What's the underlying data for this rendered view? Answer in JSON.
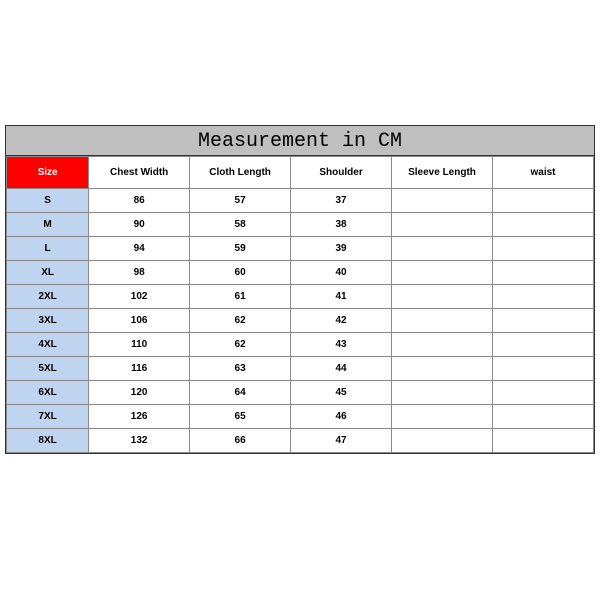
{
  "title": "Measurement in CM",
  "headers": {
    "size": "Size",
    "chest": "Chest Width",
    "length": "Cloth Length",
    "shoulder": "Shoulder",
    "sleeve": "Sleeve Length",
    "waist": "waist"
  },
  "rows": [
    {
      "size": "S",
      "chest": "86",
      "length": "57",
      "shoulder": "37",
      "sleeve": "",
      "waist": ""
    },
    {
      "size": "M",
      "chest": "90",
      "length": "58",
      "shoulder": "38",
      "sleeve": "",
      "waist": ""
    },
    {
      "size": "L",
      "chest": "94",
      "length": "59",
      "shoulder": "39",
      "sleeve": "",
      "waist": ""
    },
    {
      "size": "XL",
      "chest": "98",
      "length": "60",
      "shoulder": "40",
      "sleeve": "",
      "waist": ""
    },
    {
      "size": "2XL",
      "chest": "102",
      "length": "61",
      "shoulder": "41",
      "sleeve": "",
      "waist": ""
    },
    {
      "size": "3XL",
      "chest": "106",
      "length": "62",
      "shoulder": "42",
      "sleeve": "",
      "waist": ""
    },
    {
      "size": "4XL",
      "chest": "110",
      "length": "62",
      "shoulder": "43",
      "sleeve": "",
      "waist": ""
    },
    {
      "size": "5XL",
      "chest": "116",
      "length": "63",
      "shoulder": "44",
      "sleeve": "",
      "waist": ""
    },
    {
      "size": "6XL",
      "chest": "120",
      "length": "64",
      "shoulder": "45",
      "sleeve": "",
      "waist": ""
    },
    {
      "size": "7XL",
      "chest": "126",
      "length": "65",
      "shoulder": "46",
      "sleeve": "",
      "waist": ""
    },
    {
      "size": "8XL",
      "chest": "132",
      "length": "66",
      "shoulder": "47",
      "sleeve": "",
      "waist": ""
    }
  ],
  "chart_data": {
    "type": "table",
    "title": "Measurement in CM",
    "columns": [
      "Size",
      "Chest Width",
      "Cloth Length",
      "Shoulder",
      "Sleeve Length",
      "waist"
    ],
    "data": [
      [
        "S",
        86,
        57,
        37,
        null,
        null
      ],
      [
        "M",
        90,
        58,
        38,
        null,
        null
      ],
      [
        "L",
        94,
        59,
        39,
        null,
        null
      ],
      [
        "XL",
        98,
        60,
        40,
        null,
        null
      ],
      [
        "2XL",
        102,
        61,
        41,
        null,
        null
      ],
      [
        "3XL",
        106,
        62,
        42,
        null,
        null
      ],
      [
        "4XL",
        110,
        62,
        43,
        null,
        null
      ],
      [
        "5XL",
        116,
        63,
        44,
        null,
        null
      ],
      [
        "6XL",
        120,
        64,
        45,
        null,
        null
      ],
      [
        "7XL",
        126,
        65,
        46,
        null,
        null
      ],
      [
        "8XL",
        132,
        66,
        47,
        null,
        null
      ]
    ]
  }
}
